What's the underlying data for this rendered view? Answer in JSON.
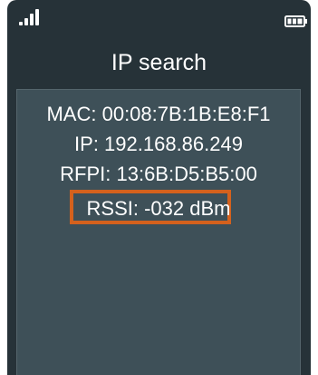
{
  "status_bar": {
    "signal_icon": "signal-strength-icon",
    "battery_icon": "battery-full-icon"
  },
  "screen": {
    "title": "IP search",
    "info": {
      "mac": "MAC: 00:08:7B:1B:E8:F1",
      "ip": "IP: 192.168.86.249",
      "rfpi": "RFPI: 13:6B:D5:B5:00",
      "rssi": "RSSI: -032 dBm"
    }
  },
  "colors": {
    "background": "#263238",
    "panel": "#3e5058",
    "highlight": "#d4611d",
    "text": "#ffffff"
  }
}
